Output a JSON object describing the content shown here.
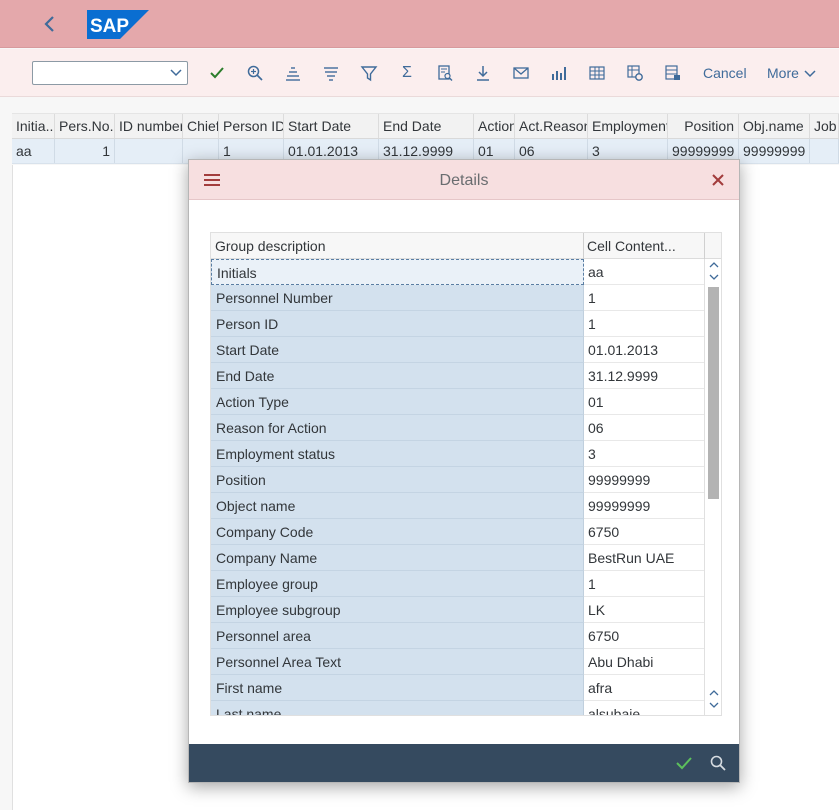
{
  "shell": {
    "logo_text": "SAP"
  },
  "toolbar": {
    "select_value": "",
    "icons": [
      "checkmark-icon",
      "zoom-icon",
      "sort-ascending-icon",
      "sort-descending-icon",
      "filter-icon",
      "sum-icon",
      "print-preview-icon",
      "download-icon",
      "mail-icon",
      "chart-icon",
      "layout-icon",
      "settings-layout-icon",
      "export-icon"
    ],
    "cancel_label": "Cancel",
    "more_label": "More"
  },
  "grid": {
    "columns": [
      "Initia...",
      "Pers.No.",
      "ID number",
      "Chief",
      "Person ID",
      "Start Date",
      "End Date",
      "Action",
      "Act.Reason",
      "Employment",
      "Position",
      "Obj.name",
      "Job"
    ],
    "row": [
      "aa",
      "1",
      "",
      "",
      "1",
      "01.01.2013",
      "31.12.9999",
      "01",
      "06",
      "3",
      "99999999",
      "99999999",
      ""
    ]
  },
  "dialog": {
    "title": "Details",
    "col_group": "Group description",
    "col_content": "Cell Content...",
    "rows": [
      {
        "k": "Initials",
        "v": "aa"
      },
      {
        "k": "Personnel Number",
        "v": "1"
      },
      {
        "k": "Person ID",
        "v": "1"
      },
      {
        "k": "Start Date",
        "v": "01.01.2013"
      },
      {
        "k": "End Date",
        "v": "31.12.9999"
      },
      {
        "k": "Action Type",
        "v": "01"
      },
      {
        "k": "Reason for Action",
        "v": "06"
      },
      {
        "k": "Employment status",
        "v": "3"
      },
      {
        "k": "Position",
        "v": "99999999"
      },
      {
        "k": "Object name",
        "v": "99999999"
      },
      {
        "k": "Company Code",
        "v": "6750"
      },
      {
        "k": "Company Name",
        "v": "BestRun UAE"
      },
      {
        "k": "Employee group",
        "v": "1"
      },
      {
        "k": "Employee subgroup",
        "v": "LK"
      },
      {
        "k": "Personnel area",
        "v": "6750"
      },
      {
        "k": "Personnel Area Text",
        "v": "Abu Dhabi"
      },
      {
        "k": "First name",
        "v": "afra"
      },
      {
        "k": "Last name",
        "v": "alsubaie"
      }
    ]
  },
  "colors": {
    "shell": "#e4a8ab",
    "toolbar": "#fbeeee",
    "dialog_header": "#f7dfe0",
    "dialog_footer": "#354a5f",
    "accent": "#3f6b9a",
    "ok_green": "#2b7d2b"
  }
}
